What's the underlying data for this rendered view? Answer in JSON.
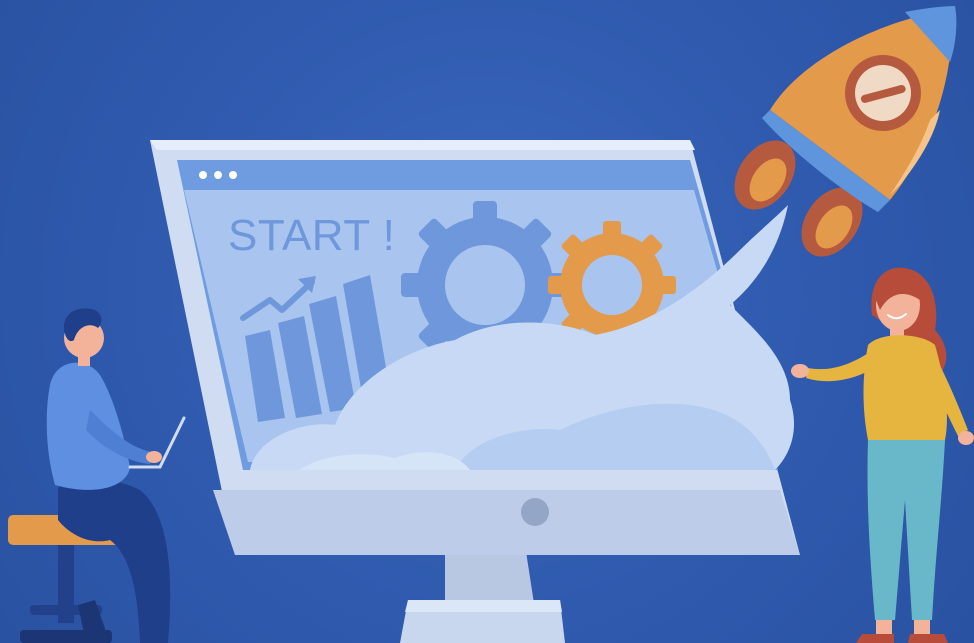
{
  "illustration": {
    "screen_text": "START !",
    "theme": "startup launch"
  },
  "icons": {
    "window_dots": "window-dots-icon",
    "growth_arrow": "growth-arrow-icon",
    "gear_large": "gear-icon",
    "gear_small": "gear-icon",
    "rocket": "rocket-icon",
    "laptop": "laptop-icon"
  },
  "colors": {
    "background": "#2f5aae",
    "monitor_body": "#cfdcf2",
    "monitor_screen": "#a9c5ef",
    "screen_frame": "#6f9be0",
    "cloud": "#c7d9f5",
    "gear_blue": "#6f98dc",
    "gear_orange": "#e39a4a",
    "rocket_body": "#e39a4a",
    "rocket_nose": "#5f95dd",
    "rocket_flame": "#b65a3f",
    "man_shirt": "#5f8fe0",
    "man_pants": "#1f3f8a",
    "stool": "#e39a4a",
    "woman_shirt": "#e5b53f",
    "woman_pants": "#69b8c9",
    "woman_hair": "#b84c3b"
  }
}
